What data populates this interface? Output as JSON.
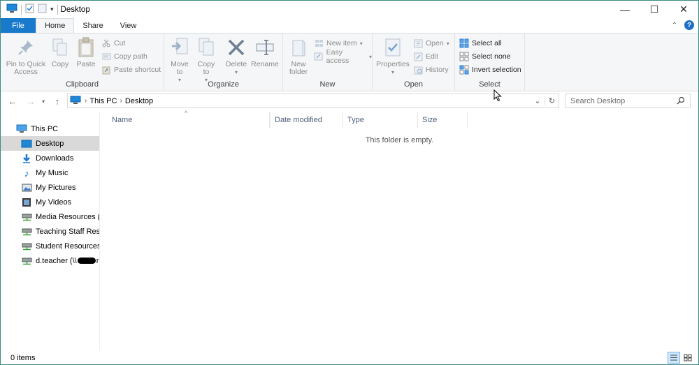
{
  "window": {
    "title": "Desktop",
    "controls": {
      "minimize": "—",
      "maximize": "☐",
      "close": "✕"
    }
  },
  "ribbon_tabs": [
    {
      "label": "File"
    },
    {
      "label": "Home"
    },
    {
      "label": "Share"
    },
    {
      "label": "View"
    }
  ],
  "ribbon": {
    "clipboard": {
      "label": "Clipboard",
      "pin": "Pin to Quick Access",
      "copy": "Copy",
      "paste": "Paste",
      "cut": "Cut",
      "copy_path": "Copy path",
      "paste_shortcut": "Paste shortcut"
    },
    "organize": {
      "label": "Organize",
      "move_to": "Move to",
      "copy_to": "Copy to",
      "delete": "Delete",
      "rename": "Rename"
    },
    "new": {
      "label": "New",
      "new_folder": "New folder",
      "new_item": "New item",
      "easy_access": "Easy access"
    },
    "open": {
      "label": "Open",
      "properties": "Properties",
      "open": "Open",
      "edit": "Edit",
      "history": "History"
    },
    "select": {
      "label": "Select",
      "select_all": "Select all",
      "select_none": "Select none",
      "invert_selection": "Invert selection"
    }
  },
  "address": {
    "crumbs": [
      "This PC",
      "Desktop"
    ],
    "search_placeholder": "Search Desktop"
  },
  "nav_pane": {
    "items": [
      {
        "label": "This PC"
      },
      {
        "label": "Desktop"
      },
      {
        "label": "Downloads"
      },
      {
        "label": "My Music"
      },
      {
        "label": "My Pictures"
      },
      {
        "label": "My Videos"
      },
      {
        "label": "Media Resources (J:"
      },
      {
        "label": "Teaching Staff Reso"
      },
      {
        "label": "Student Resources ("
      },
      {
        "label": "d.teacher (\\\\"
      }
    ]
  },
  "columns": [
    "Name",
    "Date modified",
    "Type",
    "Size"
  ],
  "empty_message": "This folder is empty.",
  "status": {
    "items": "0 items"
  },
  "colors": {
    "accent": "#1979ca",
    "selected": "#d9d9d9",
    "header_text": "#4c607a"
  }
}
